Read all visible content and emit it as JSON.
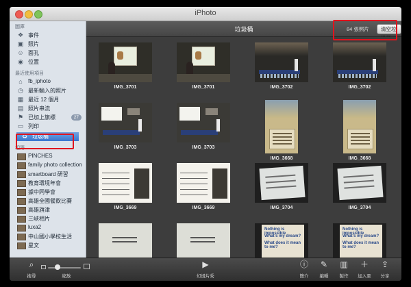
{
  "window": {
    "title": "iPhoto"
  },
  "sidebar": {
    "library_header": "圖庫",
    "library_items": [
      {
        "label": "事件",
        "icon": "events-icon"
      },
      {
        "label": "照片",
        "icon": "photos-icon"
      },
      {
        "label": "面孔",
        "icon": "faces-icon"
      },
      {
        "label": "位置",
        "icon": "places-icon"
      }
    ],
    "recent_header": "最近使用項目",
    "recent_items": [
      {
        "label": "fb_iphoto",
        "icon": "facebook-icon"
      },
      {
        "label": "最新輸入的照片",
        "icon": "import-icon"
      },
      {
        "label": "最近 12 個月",
        "icon": "calendar-icon"
      },
      {
        "label": "照片串流",
        "icon": "photostream-icon"
      },
      {
        "label": "已加上旗標",
        "icon": "flag-icon",
        "badge": "27"
      },
      {
        "label": "列印",
        "icon": "print-icon"
      },
      {
        "label": "垃圾桶",
        "icon": "trash-icon",
        "selected": true
      }
    ],
    "albums_header": "相簿",
    "album_items": [
      {
        "label": "PINCHES"
      },
      {
        "label": "family photo collection"
      },
      {
        "label": "smartboard 研習"
      },
      {
        "label": "教育環境年會"
      },
      {
        "label": "據中同學會"
      },
      {
        "label": "高雄全國餐飲比賽"
      },
      {
        "label": "高雄旗津"
      },
      {
        "label": "三峽相片"
      },
      {
        "label": "luxa2"
      },
      {
        "label": "中山國小學校生活"
      },
      {
        "label": "星文"
      }
    ]
  },
  "main": {
    "title": "垃圾桶",
    "photo_count": "84 張照片",
    "empty_trash_label": "清空垃圾桶",
    "photos": [
      {
        "name": "IMG_3701",
        "style": "class",
        "orient": "land"
      },
      {
        "name": "IMG_3701",
        "style": "class",
        "orient": "land"
      },
      {
        "name": "IMG_3702",
        "style": "stage",
        "orient": "land"
      },
      {
        "name": "IMG_3702",
        "style": "stage",
        "orient": "land"
      },
      {
        "name": "IMG_3703",
        "style": "bright",
        "orient": "land"
      },
      {
        "name": "IMG_3703",
        "style": "bright",
        "orient": "land"
      },
      {
        "name": "IMG_3668",
        "style": "poster",
        "orient": "port"
      },
      {
        "name": "IMG_3668",
        "style": "poster",
        "orient": "port"
      },
      {
        "name": "IMG_3669",
        "style": "text",
        "orient": "land"
      },
      {
        "name": "IMG_3669",
        "style": "text",
        "orient": "land"
      },
      {
        "name": "IMG_3704",
        "style": "paper",
        "orient": "land"
      },
      {
        "name": "IMG_3704",
        "style": "paper",
        "orient": "land"
      },
      {
        "name": "",
        "style": "page",
        "orient": "land"
      },
      {
        "name": "",
        "style": "page",
        "orient": "land"
      },
      {
        "name": "",
        "style": "hn",
        "orient": "land",
        "lines": [
          "Nothing is impossible",
          "What's my dream?",
          "What does it mean to me?"
        ]
      },
      {
        "name": "",
        "style": "hn",
        "orient": "land",
        "lines": [
          "Nothing is impossible",
          "What's my dream?",
          "What does it mean to me?"
        ]
      }
    ]
  },
  "toolbar": {
    "search_label": "搜尋",
    "zoom_label": "縮放",
    "slideshow_label": "幻燈片秀",
    "info_label": "簡介",
    "edit_label": "編輯",
    "create_label": "製作",
    "add_label": "加入至",
    "share_label": "分享"
  },
  "highlight_color": "#e0141e"
}
